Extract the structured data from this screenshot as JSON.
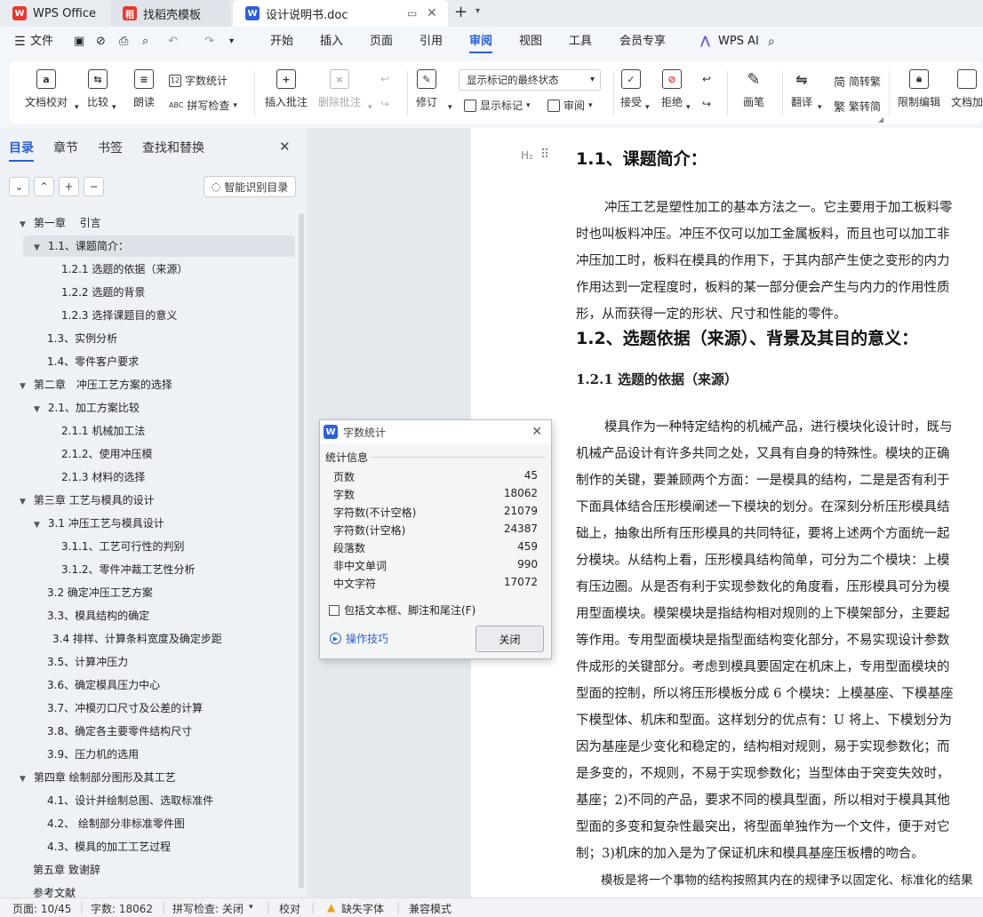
{
  "titlebar": {
    "tabs": [
      {
        "label": "WPS Office"
      },
      {
        "label": "找稻壳模板"
      },
      {
        "label": "设计说明书.doc"
      }
    ]
  },
  "menubar": {
    "file": "文件",
    "items": [
      "开始",
      "插入",
      "页面",
      "引用",
      "审阅",
      "视图",
      "工具",
      "会员专享"
    ],
    "active": "审阅",
    "ai": "WPS AI"
  },
  "ribbon": {
    "doc_check": "文档校对",
    "compare": "比较",
    "read": "朗读",
    "word_count": "字数统计",
    "spell_check": "拼写检查",
    "insert_comment": "插入批注",
    "delete_comment": "删除批注",
    "revise": "修订",
    "markup_state": "显示标记的最终状态",
    "show_markup": "显示标记",
    "review": "审阅",
    "accept": "接受",
    "reject": "拒绝",
    "pen": "画笔",
    "translate": "翻译",
    "to_traditional": "简转繁",
    "to_simplified": "繁转简",
    "restrict_edit": "限制编辑",
    "doc_more": "文档加"
  },
  "sidebar": {
    "tabs": [
      "目录",
      "章节",
      "书签",
      "查找和替换"
    ],
    "active_tab": "目录",
    "smart_btn": "智能识别目录",
    "toc": [
      {
        "text": "第一章　 引言"
      },
      {
        "text": "1.1、课题简介："
      },
      {
        "text": "1.2.1 选题的依据（来源）"
      },
      {
        "text": "1.2.2 选题的背景"
      },
      {
        "text": "1.2.3 选择课题目的意义"
      },
      {
        "text": "1.3、实例分析"
      },
      {
        "text": "1.4、零件客户要求"
      },
      {
        "text": "第二章　冲压工艺方案的选择"
      },
      {
        "text": "2.1、加工方案比较"
      },
      {
        "text": "2.1.1 机械加工法"
      },
      {
        "text": "2.1.2、使用冲压模"
      },
      {
        "text": "2.1.3 材料的选择"
      },
      {
        "text": "第三章  工艺与模具的设计"
      },
      {
        "text": "3.1 冲压工艺与模具设计"
      },
      {
        "text": "3.1.1、工艺可行性的判别"
      },
      {
        "text": "3.1.2、零件冲裁工艺性分析"
      },
      {
        "text": "3.2 确定冲压工艺方案"
      },
      {
        "text": "3.3、模具结构的确定"
      },
      {
        "text": "3.4 排样、计算条料宽度及确定步距"
      },
      {
        "text": "3.5、计算冲压力"
      },
      {
        "text": "3.6、确定模具压力中心"
      },
      {
        "text": "3.7、冲模刃口尺寸及公差的计算"
      },
      {
        "text": "3.8、确定各主要零件结构尺寸"
      },
      {
        "text": "3.9、压力机的选用"
      },
      {
        "text": "第四章  绘制部分图形及其工艺"
      },
      {
        "text": "4.1、设计并绘制总图、选取标准件"
      },
      {
        "text": "4.2、  绘制部分非标准零件图"
      },
      {
        "text": "4.3、模具的加工工艺过程"
      },
      {
        "text": "第五章  致谢辞"
      },
      {
        "text": "参考文献"
      }
    ]
  },
  "document": {
    "heading_marker": "H₂",
    "h1_title": "1.1、课题简介：",
    "p1": [
      "冲压工艺是塑性加工的基本方法之一。它主要用于加工板料零",
      "时也叫板料冲压。冲压不仅可以加工金属板料，而且也可以加工非",
      "冲压加工时，板料在模具的作用下，于其内部产生使之变形的内力",
      "作用达到一定程度时，板料的某一部分便会产生与内力的作用性质",
      "形，从而获得一定的形状、尺寸和性能的零件。"
    ],
    "h2_title": "1.2、选题依据（来源）、背景及其目的意义：",
    "h3_title": "1.2.1 选题的依据（来源）",
    "p2": [
      "模具作为一种特定结构的机械产品，进行模块化设计时，既与",
      "机械产品设计有许多共同之处，又具有自身的特殊性。模块的正确",
      "制作的关键，要兼顾两个方面：一是模具的结构，二是是否有利于",
      "下面具体结合压形模阐述一下模块的划分。在深刻分析压形模具结",
      "础上，抽象出所有压形模具的共同特征，要将上述两个方面统一起",
      "分模块。从结构上看，压形模具结构简单，可分为二个模块：上模",
      "有压边圈。从是否有利于实现参数化的角度看，压形模具可分为模",
      "用型面模块。模架模块是指结构相对规则的上下模架部分，主要起",
      "等作用。专用型面模块是指型面结构变化部分，不易实现设计参数",
      "件成形的关键部分。考虑到模具要固定在机床上，专用型面模块的",
      "型面的控制，所以将压形模板分成 6 个模块：上模基座、下模基座",
      "下模型体、机床和型面。这样划分的优点有：U 将上、下模划分为",
      "因为基座是少变化和稳定的，结构相对规则，易于实现参数化；而",
      "是多变的，不规则，不易于实现参数化；当型体由于突变失效时，",
      "基座；2)不同的产品，要求不同的模具型面，所以相对于模具其他",
      "型面的多变和复杂性最突出，将型面单独作为一个文件，便于对它",
      "制；3)机床的加入是为了保证机床和模具基座压板槽的吻合。"
    ],
    "p3": "模板是将一个事物的结构按照其内在的规律予以固定化、标准化的结果"
  },
  "dialog": {
    "title": "字数统计",
    "section": "统计信息",
    "rows": [
      {
        "label": "页数",
        "value": "45"
      },
      {
        "label": "字数",
        "value": "18062"
      },
      {
        "label": "字符数(不计空格)",
        "value": "21079"
      },
      {
        "label": "字符数(计空格)",
        "value": "24387"
      },
      {
        "label": "段落数",
        "value": "459"
      },
      {
        "label": "非中文单词",
        "value": "990"
      },
      {
        "label": "中文字符",
        "value": "17072"
      }
    ],
    "checkbox_label": "包括文本框、脚注和尾注(F)",
    "tips": "操作技巧",
    "close": "关闭"
  },
  "statusbar": {
    "page": "页面: 10/45",
    "words": "字数: 18062",
    "spell": "拼写检查: 关闭",
    "proof": "校对",
    "missing_font": "缺失字体",
    "compat": "兼容模式"
  },
  "colors": {
    "accent": "#2b5fd9",
    "wps_red": "#e8392e",
    "doc_blue": "#2f5fd8"
  }
}
